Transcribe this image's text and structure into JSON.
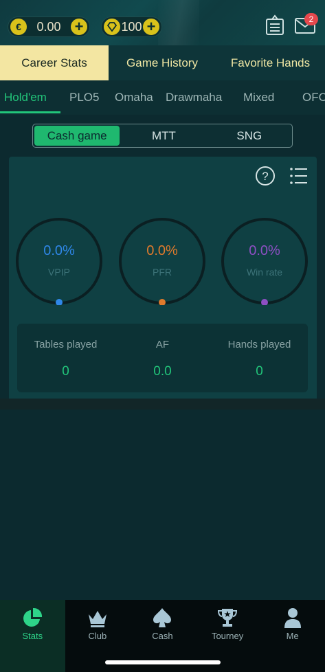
{
  "header": {
    "coins": {
      "icon": "euro-icon",
      "amount": "0.00",
      "add": "+"
    },
    "diamonds": {
      "icon": "diamond-icon",
      "amount": "100",
      "add": "+"
    },
    "notes_icon": "clipboard-icon",
    "mail_icon": "mail-icon",
    "mail_badge": "2"
  },
  "main_tabs": [
    {
      "label": "Career Stats",
      "active": true
    },
    {
      "label": "Game History",
      "active": false
    },
    {
      "label": "Favorite Hands",
      "active": false
    }
  ],
  "sub_tabs": [
    {
      "label": "Hold'em",
      "active": true
    },
    {
      "label": "PLO5"
    },
    {
      "label": "Omaha"
    },
    {
      "label": "Drawmaha"
    },
    {
      "label": "Mixed"
    },
    {
      "label": "OFC"
    }
  ],
  "game_type": {
    "options": [
      "Cash game",
      "MTT",
      "SNG"
    ],
    "selected": "Cash game"
  },
  "rings": [
    {
      "value": "0.0%",
      "name": "VPIP",
      "color": "#2f87e8"
    },
    {
      "value": "0.0%",
      "name": "PFR",
      "color": "#e07a2c"
    },
    {
      "value": "0.0%",
      "name": "Win rate",
      "color": "#8e4fc4"
    }
  ],
  "summary": [
    {
      "title": "Tables played",
      "value": "0"
    },
    {
      "title": "AF",
      "value": "0.0"
    },
    {
      "title": "Hands played",
      "value": "0"
    }
  ],
  "bottom_nav": [
    {
      "label": "Stats",
      "icon": "stats-pie-icon",
      "active": true
    },
    {
      "label": "Club",
      "icon": "crown-icon"
    },
    {
      "label": "Cash",
      "icon": "spade-icon"
    },
    {
      "label": "Tourney",
      "icon": "trophy-icon"
    },
    {
      "label": "Me",
      "icon": "person-icon"
    }
  ],
  "colors": {
    "accent_green": "#22c57a",
    "gold": "#d9c21b",
    "tab_active_bg": "#f3e6a2"
  }
}
